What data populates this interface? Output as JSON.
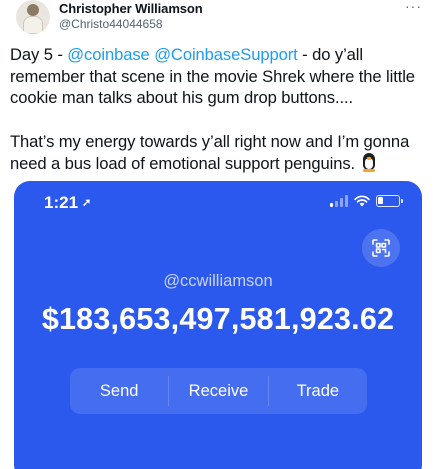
{
  "tweet": {
    "author_name": "Christopher Williamson",
    "author_handle": "@Christo44044658",
    "more_label": "···",
    "line1_prefix": "Day 5 - ",
    "mention1": "@coinbase",
    "mention2": "@CoinbaseSupport",
    "line1_suffix": "  - do y’all remember that scene in the movie Shrek where the little cookie man talks about his gum drop buttons....",
    "paragraph2": "That’s my energy towards y’all right now and I’m gonna need a bus load of emotional support penguins. ",
    "emoji": "penguin-icon"
  },
  "phone": {
    "time": "1:21",
    "location_icon": "location-arrow-icon",
    "username": "@ccwilliamson",
    "balance": "$183,653,497,581,923.62",
    "actions": {
      "send": "Send",
      "receive": "Receive",
      "trade": "Trade"
    },
    "accent_color": "#2c59ed"
  }
}
